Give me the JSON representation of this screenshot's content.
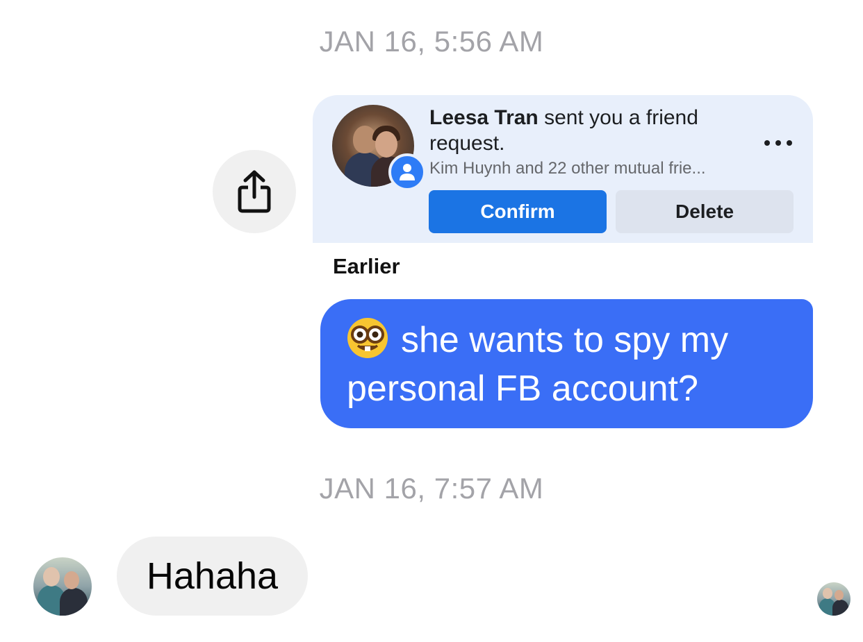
{
  "thread": {
    "timestamp_1": "JAN 16, 5:56 AM",
    "timestamp_2": "JAN 16, 7:57 AM"
  },
  "shared_card": {
    "sender_name": "Leesa Tran",
    "title_rest": " sent you a friend request.",
    "mutual_friends": "Kim Huynh and 22 other mutual frie...",
    "confirm_label": "Confirm",
    "delete_label": "Delete",
    "section_label": "Earlier"
  },
  "outgoing_message": {
    "emoji": "nerd-face",
    "text": "she wants to spy my personal FB account?"
  },
  "incoming_message": {
    "text": "Hahaha"
  },
  "icons": {
    "share": "share-icon",
    "more": "more-horizontal-icon",
    "person_badge": "person-icon"
  },
  "colors": {
    "outgoing_bubble": "#3a6ef6",
    "incoming_bubble": "#f0f0f0",
    "confirm_button": "#1b74e4",
    "card_background": "#e8effb",
    "timestamp": "#a3a3a8"
  }
}
